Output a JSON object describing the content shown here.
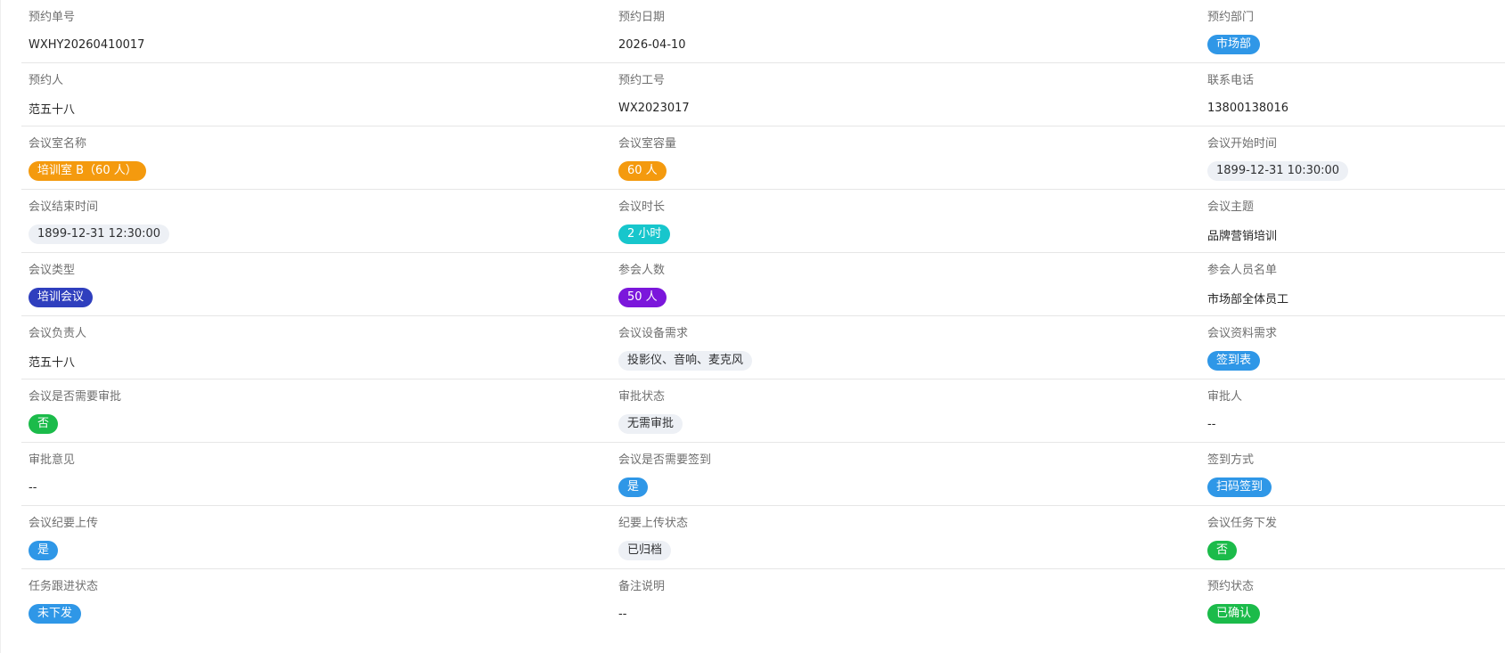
{
  "rows": [
    [
      {
        "label": "预约单号",
        "value": "WXHY20260410017"
      },
      {
        "label": "预约日期",
        "value": "2026-04-10"
      },
      {
        "label": "预约部门",
        "value": "市场部"
      }
    ],
    [
      {
        "label": "预约人",
        "value": "范五十八"
      },
      {
        "label": "预约工号",
        "value": "WX2023017"
      },
      {
        "label": "联系电话",
        "value": "13800138016"
      }
    ],
    [
      {
        "label": "会议室名称",
        "value": "培训室 B（60 人）"
      },
      {
        "label": "会议室容量",
        "value": "60 人"
      },
      {
        "label": "会议开始时间",
        "value": "1899-12-31 10:30:00"
      }
    ],
    [
      {
        "label": "会议结束时间",
        "value": "1899-12-31 12:30:00"
      },
      {
        "label": "会议时长",
        "value": "2 小时"
      },
      {
        "label": "会议主题",
        "value": "品牌营销培训"
      }
    ],
    [
      {
        "label": "会议类型",
        "value": "培训会议"
      },
      {
        "label": "参会人数",
        "value": "50 人"
      },
      {
        "label": "参会人员名单",
        "value": "市场部全体员工"
      }
    ],
    [
      {
        "label": "会议负责人",
        "value": "范五十八"
      },
      {
        "label": "会议设备需求",
        "value": "投影仪、音响、麦克风"
      },
      {
        "label": "会议资料需求",
        "value": "签到表"
      }
    ],
    [
      {
        "label": "会议是否需要审批",
        "value": "否"
      },
      {
        "label": "审批状态",
        "value": "无需审批"
      },
      {
        "label": "审批人",
        "value": "--"
      }
    ],
    [
      {
        "label": "审批意见",
        "value": "--"
      },
      {
        "label": "会议是否需要签到",
        "value": "是"
      },
      {
        "label": "签到方式",
        "value": "扫码签到"
      }
    ],
    [
      {
        "label": "会议纪要上传",
        "value": "是"
      },
      {
        "label": "纪要上传状态",
        "value": "已归档"
      },
      {
        "label": "会议任务下发",
        "value": "否"
      }
    ],
    [
      {
        "label": "任务跟进状态",
        "value": "未下发"
      },
      {
        "label": "备注说明",
        "value": "--"
      },
      {
        "label": "预约状态",
        "value": "已确认"
      }
    ]
  ],
  "tag_colors": {
    "blue": "#2f97e7",
    "orange": "#f49a0e",
    "cyan": "#17c6cc",
    "indigo": "#2f3fbe",
    "purple": "#7b17db",
    "green": "#1bbb4a",
    "gray": "#edf0f5"
  }
}
